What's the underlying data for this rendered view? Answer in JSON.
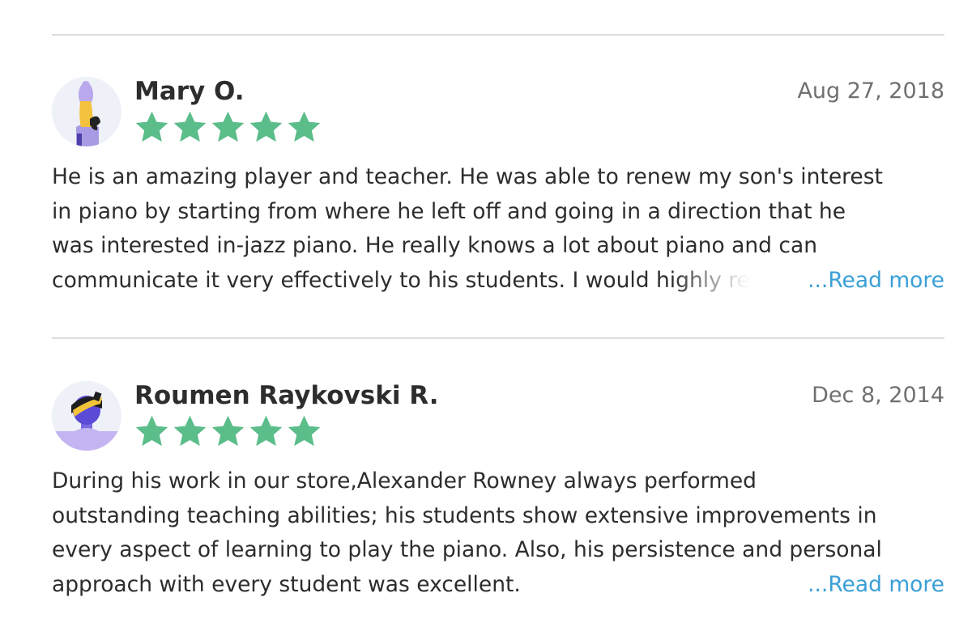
{
  "colors": {
    "star": "#5bbd8a",
    "link": "#3a9fd6",
    "date": "#707070",
    "text": "#2d2d2d"
  },
  "reviews": [
    {
      "name": "Mary O.",
      "date": "Aug 27, 2018",
      "rating": 5,
      "lines": [
        "He is an amazing player and teacher. He was able to renew my son's interest",
        "in piano by starting from where he left off and going in a direction that he",
        "was interested in-jazz piano. He really knows a lot about piano and can",
        "communicate it very effectively to his students. I would highly re"
      ],
      "read_more": "...Read more"
    },
    {
      "name": "Roumen Raykovski R.",
      "date": "Dec 8, 2014",
      "rating": 5,
      "lines": [
        "During his work in our store,Alexander Rowney always performed",
        "outstanding teaching abilities; his students show extensive improvements in",
        "every aspect of learning to play the piano. Also, his persistence and personal",
        "approach with every student was excellent."
      ],
      "read_more": "...Read more"
    }
  ]
}
